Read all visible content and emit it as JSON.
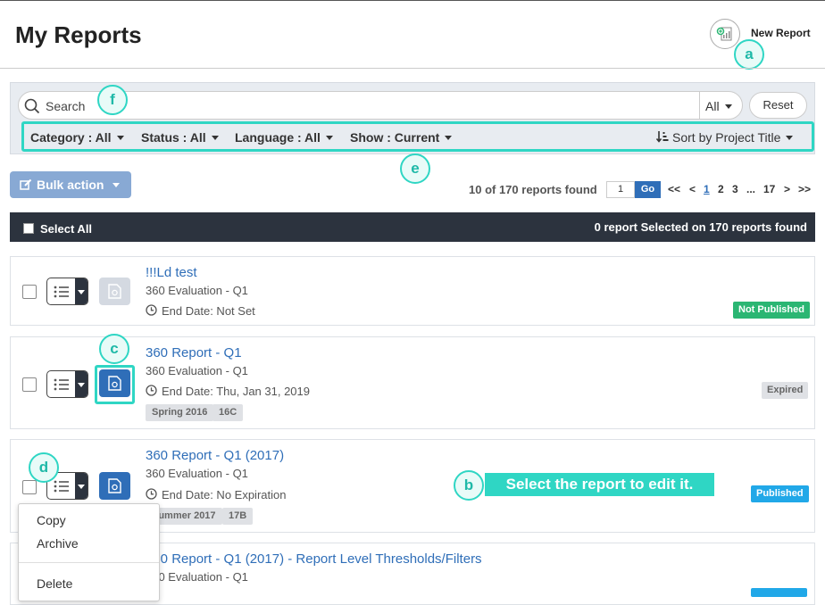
{
  "header": {
    "title": "My Reports",
    "new_report_label": "New Report"
  },
  "callouts": {
    "a": "a",
    "b": "b",
    "c": "c",
    "d": "d",
    "e": "e",
    "f": "f",
    "tooltip": "Select the report to edit it."
  },
  "search": {
    "placeholder": "Search",
    "scope": "All",
    "reset": "Reset"
  },
  "filters": {
    "category": "Category : All",
    "status": "Status : All",
    "language": "Language : All",
    "show": "Show : Current",
    "sort": "Sort by Project Title"
  },
  "toolbar": {
    "bulk_action": "Bulk action",
    "count": "10 of 170 reports found",
    "page_value": "1",
    "go": "Go",
    "pager": [
      "<<",
      "<",
      "1",
      "2",
      "3",
      "...",
      "17",
      ">",
      ">>"
    ]
  },
  "selection": {
    "select_all": "Select All",
    "summary": "0 report Selected on 170 reports found"
  },
  "reports": [
    {
      "title": "!!!Ld test",
      "subtitle": "360 Evaluation - Q1",
      "end_date": "End Date: Not Set",
      "tags": [],
      "status": "Not Published"
    },
    {
      "title": "360 Report - Q1",
      "subtitle": "360 Evaluation - Q1",
      "end_date": "End Date: Thu, Jan 31, 2019",
      "tags": [
        "Spring 2016",
        "16C"
      ],
      "status": "Expired"
    },
    {
      "title": "360 Report - Q1 (2017)",
      "subtitle": "360 Evaluation - Q1",
      "end_date": "End Date: No Expiration",
      "tags": [
        "Summer 2017",
        "17B"
      ],
      "status": "Published"
    },
    {
      "title": "360 Report - Q1 (2017) - Report Level Thresholds/Filters",
      "subtitle": "360 Evaluation - Q1"
    }
  ],
  "context_menu": {
    "items": [
      "Copy",
      "Archive",
      "Delete"
    ]
  },
  "colors": {
    "accent": "#2fd6c4",
    "primary": "#2f6eb8",
    "not_published": "#2bb673",
    "published": "#21a8e8",
    "expired": "#dfe1e5",
    "dark_bar": "#2c333e"
  }
}
